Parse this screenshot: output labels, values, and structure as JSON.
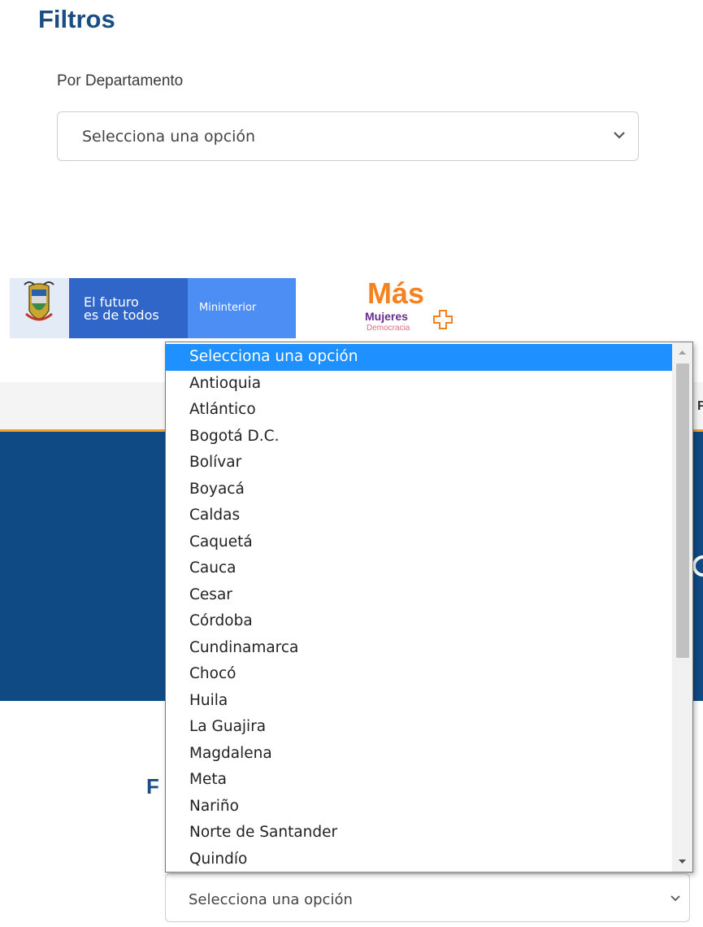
{
  "filters": {
    "title": "Filtros",
    "department_label": "Por Departamento",
    "department_select_value": "Selecciona una opción"
  },
  "header": {
    "slogan_line1": "El futuro",
    "slogan_line2": "es de todos",
    "ministry": "Mininterior",
    "logo_mas": "Más",
    "logo_mujeres": "Mujeres",
    "logo_democracia": "Democracia",
    "nav_peek": "F"
  },
  "section2": {
    "title_peek": "F",
    "select_value": "Selecciona una opción"
  },
  "dropdown": {
    "selected_index": 0,
    "options": [
      "Selecciona una opción",
      "Antioquia",
      "Atlántico",
      "Bogotá D.C.",
      "Bolívar",
      "Boyacá",
      "Caldas",
      "Caquetá",
      "Cauca",
      "Cesar",
      "Córdoba",
      "Cundinamarca",
      "Chocó",
      "Huila",
      "La Guajira",
      "Magdalena",
      "Meta",
      "Nariño",
      "Norte de Santander",
      "Quindío"
    ]
  },
  "colors": {
    "title_blue": "#1a4d83",
    "hero_blue": "#0f4a85",
    "selection_blue": "#1e90ff",
    "accent_orange": "#f39c27",
    "gov_blue": "#3166c9",
    "gov_light_blue": "#4d8ef4",
    "brand_purple": "#6a2c8f"
  },
  "icons": [
    "chevron-down-icon",
    "colombia-shield-icon",
    "plus-icon",
    "scroll-up-arrow-icon",
    "scroll-down-arrow-icon"
  ]
}
